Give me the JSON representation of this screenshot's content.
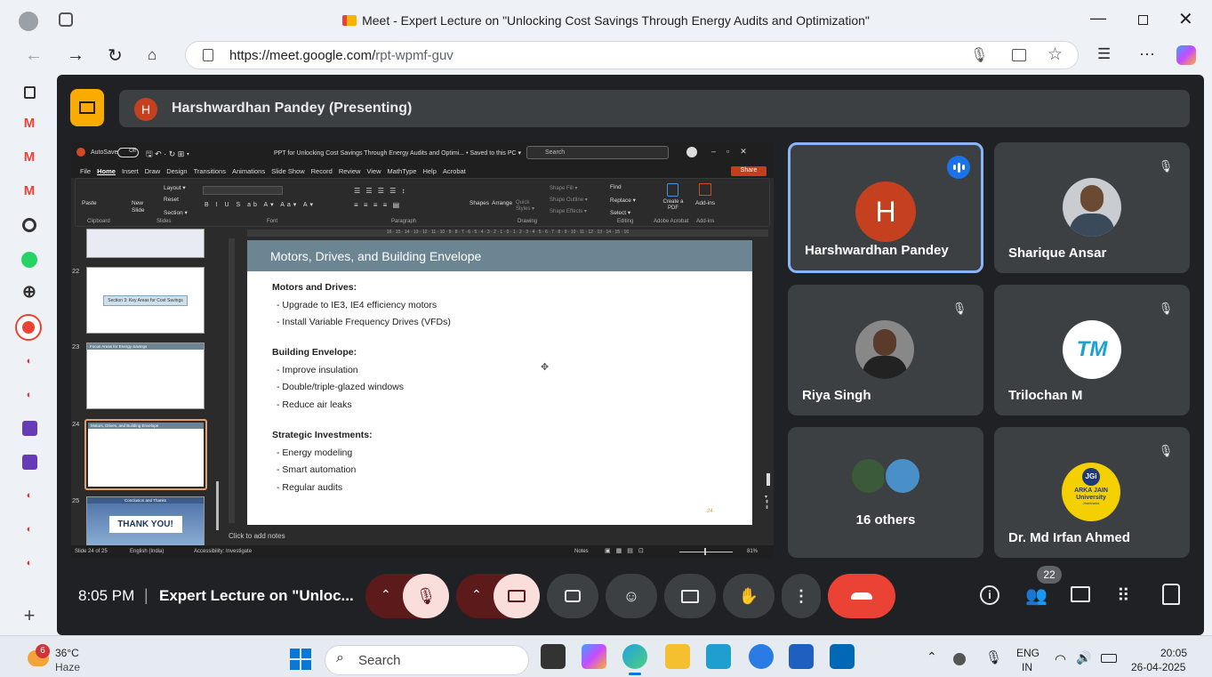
{
  "browser": {
    "tab_title": "Meet - Expert Lecture on \"Unlocking Cost Savings Through Energy Audits and Optimization\"",
    "url_host": "https://meet.google.com/",
    "url_path": "rpt-wpmf-guv"
  },
  "presenter": {
    "initial": "H",
    "label": "Harshwardhan Pandey (Presenting)"
  },
  "ppt": {
    "autosave": "AutoSave",
    "autosave_state": "Off",
    "doc_title": "PPT for Unlocking Cost Savings Through Energy Audits and Optimi... • Saved to this PC ▾",
    "search_placeholder": "Search",
    "menu": [
      "File",
      "Home",
      "Insert",
      "Draw",
      "Design",
      "Transitions",
      "Animations",
      "Slide Show",
      "Record",
      "Review",
      "View",
      "MathType",
      "Help",
      "Acrobat"
    ],
    "share_label": "Share",
    "ribbon_groups": [
      "Clipboard",
      "Slides",
      "Font",
      "Paragraph",
      "Drawing",
      "Editing",
      "Adobe Acrobat",
      "Add-ins"
    ],
    "ribbon_buttons": {
      "paste": "Paste",
      "new_slide": "New Slide",
      "layout": "Layout ▾",
      "reset": "Reset",
      "section": "Section ▾",
      "shapes": "Shapes",
      "arrange": "Arrange",
      "quick_styles": "Quick Styles ▾",
      "shape_fill": "Shape Fill ▾",
      "shape_outline": "Shape Outline ▾",
      "shape_effects": "Shape Effects ▾",
      "find": "Find",
      "replace": "Replace ▾",
      "select": "Select ▾",
      "create_pdf": "Create a PDF",
      "addins": "Add-ins"
    },
    "ruler": "16 · 15 · 14 · 13 · 12 · 11 · 10 · 9 · 8 · 7 · 6 · 5 · 4 · 3 · 2 · 1 · 0 · 1 · 2 · 3 · 4 · 5 · 6 · 7 · 8 · 9 · 10 · 11 · 12 · 13 · 14 · 15 · 16",
    "thumbnails": [
      {
        "num": "22",
        "text": "Section 3: Key Areas for Cost Savings"
      },
      {
        "num": "23",
        "text": "Focus Areas for Energy Savings"
      },
      {
        "num": "24",
        "text": "Motors, Drives, and Building Envelope"
      },
      {
        "num": "25",
        "text": "THANK YOU!"
      }
    ],
    "thumb25_header": "Conclusion and Thanks",
    "slide": {
      "title": "Motors, Drives, and Building Envelope",
      "sections": [
        {
          "heading": "Motors and Drives:",
          "items": [
            "- Upgrade to IE3, IE4 efficiency motors",
            "- Install Variable Frequency Drives (VFDs)"
          ]
        },
        {
          "heading": "Building Envelope:",
          "items": [
            "- Improve insulation",
            "- Double/triple-glazed windows",
            "- Reduce air leaks"
          ]
        },
        {
          "heading": "Strategic Investments:",
          "items": [
            "- Energy modeling",
            "- Smart automation",
            "- Regular audits"
          ]
        }
      ],
      "page_number": "24"
    },
    "notes_placeholder": "Click to add notes",
    "status": {
      "slide_of": "Slide 24 of 25",
      "language": "English (India)",
      "accessibility": "Accessibility: Investigate",
      "notes": "Notes",
      "zoom": "81%"
    }
  },
  "participants": [
    {
      "name": "Harshwardhan Pandey",
      "initial": "H",
      "speaking": true
    },
    {
      "name": "Sharique Ansar"
    },
    {
      "name": "Riya Singh"
    },
    {
      "name": "Trilochan M"
    },
    {
      "name": "16 others"
    },
    {
      "name": "Dr. Md Irfan Ahmed"
    }
  ],
  "logos": {
    "trilochan": "TM",
    "jain_top": "JGi",
    "jain_name": "ARKA JAIN University",
    "jain_sub": "Jharkhand"
  },
  "call": {
    "time": "8:05 PM",
    "divider": "|",
    "meeting_title": "Expert Lecture on \"Unloc...",
    "people_count": "22"
  },
  "taskbar": {
    "notif_count": "6",
    "temperature": "36°C",
    "weather": "Haze",
    "search_placeholder": "Search",
    "lang_top": "ENG",
    "lang_bottom": "IN",
    "clock_time": "20:05",
    "clock_date": "26-04-2025"
  },
  "colors": {
    "meet_bg": "#202124",
    "tile_bg": "#3c4043",
    "active_border": "#8ab4f8",
    "end_call": "#ea4335",
    "muted_red": "#5c1a1a",
    "muted_pink": "#f9dedc",
    "ppt_title_bar": "#6b8592",
    "presenter_avatar": "#c5401f"
  }
}
